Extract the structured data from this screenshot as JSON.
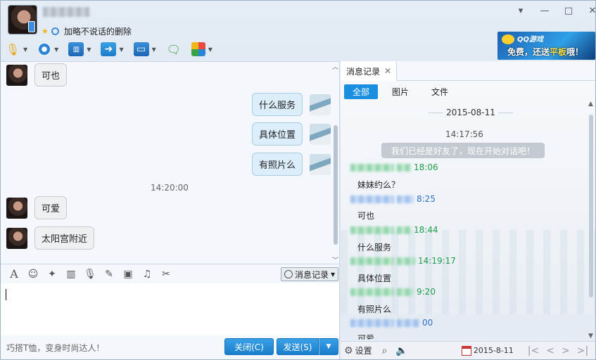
{
  "header": {
    "signature": "加略不说话的删除"
  },
  "ad": {
    "brand": "QQ游戏",
    "text_prefix": "免费，还送",
    "text_highlight": "平板",
    "text_suffix": "哦！"
  },
  "chat": {
    "messages": [
      {
        "side": "her",
        "text": "可也"
      },
      {
        "side": "me",
        "text": "什么服务"
      },
      {
        "side": "me",
        "text": "具体位置"
      },
      {
        "side": "me",
        "text": "有照片么"
      },
      {
        "side": "her",
        "text": "可爱"
      },
      {
        "side": "her",
        "text": "太阳宫附近"
      }
    ],
    "timestamp": "14:20:00"
  },
  "input": {
    "history_button": "消息记录",
    "tip": "巧搭T恤，变身时尚达人！",
    "close_button": "关闭(C)",
    "send_button": "发送(S)"
  },
  "history": {
    "tab_label": "消息记录",
    "filters": [
      "全部",
      "图片",
      "文件"
    ],
    "date": "2015-08-11",
    "system_time": "14:17:56",
    "system_message": "我们已经是好友了，现在开始对话吧！",
    "entries": [
      {
        "time": "18:06",
        "text": "妹妹约么？",
        "color": "green"
      },
      {
        "time": "8:25",
        "text": "可也",
        "color": "blue"
      },
      {
        "time": "18:44",
        "text": "什么服务",
        "color": "green"
      },
      {
        "time": "14:19:17",
        "text": "具体位置",
        "color": "green"
      },
      {
        "time": "9:20",
        "text": "有照片么",
        "color": "green"
      },
      {
        "time": "00",
        "text": "可爱",
        "color": "blue"
      }
    ],
    "settings_label": "设置",
    "bottom_date": "2015-8-11"
  },
  "colors": {
    "accent": "#1a8fe0",
    "green_name": "#1f9e4a",
    "blue_name": "#2f6fd1"
  }
}
